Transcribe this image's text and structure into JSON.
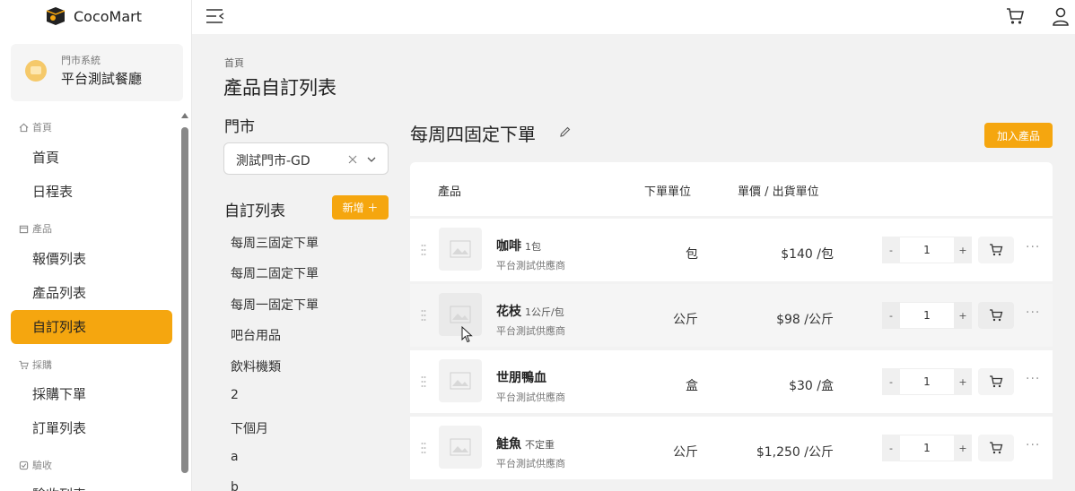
{
  "app": {
    "name": "CocoMart"
  },
  "store_card": {
    "subtitle": "門市系統",
    "name": "平台測試餐廳"
  },
  "sidebar": {
    "groups": [
      {
        "label": "首頁",
        "icon": "home-icon"
      },
      {
        "label": "產品",
        "icon": "box-icon"
      },
      {
        "label": "採購",
        "icon": "cart-icon"
      },
      {
        "label": "驗收",
        "icon": "check-icon"
      }
    ],
    "items": [
      {
        "label": "首頁"
      },
      {
        "label": "日程表"
      },
      {
        "label": "報價列表"
      },
      {
        "label": "產品列表"
      },
      {
        "label": "自訂列表",
        "active": true
      },
      {
        "label": "採購下單"
      },
      {
        "label": "訂單列表"
      },
      {
        "label": "驗收列表"
      }
    ]
  },
  "page": {
    "breadcrumb": "首頁",
    "title": "產品自訂列表"
  },
  "store_filter": {
    "label": "門市",
    "value": "測試門市-GD"
  },
  "custom_lists": {
    "label": "自訂列表",
    "add_label": "新增 ＋",
    "items": [
      "每周三固定下單",
      "每周二固定下單",
      "每周一固定下單",
      "吧台用品",
      "飲料機類",
      "2",
      "下個月",
      "a",
      "b"
    ]
  },
  "detail": {
    "title": "每周四固定下單",
    "add_product_label": "加入產品",
    "columns": {
      "product": "產品",
      "order_unit": "下單單位",
      "price": "單價 / 出貨單位"
    },
    "rows": [
      {
        "name": "咖啡",
        "spec": "1包",
        "supplier": "平台測試供應商",
        "order_unit": "包",
        "price": "$140 /包",
        "qty": "1"
      },
      {
        "name": "花枝",
        "spec": "1公斤/包",
        "supplier": "平台測試供應商",
        "order_unit": "公斤",
        "price": "$98 /公斤",
        "qty": "1"
      },
      {
        "name": "世朋鴨血",
        "spec": "",
        "supplier": "平台測試供應商",
        "order_unit": "盒",
        "price": "$30 /盒",
        "qty": "1"
      },
      {
        "name": "鮭魚",
        "spec": "不定重",
        "supplier": "平台測試供應商",
        "order_unit": "公斤",
        "price": "$1,250 /公斤",
        "qty": "1"
      }
    ],
    "stepper": {
      "minus": "-",
      "plus": "+"
    },
    "more": "···"
  },
  "colors": {
    "accent": "#f5a60f",
    "background": "#f2f2f2"
  }
}
